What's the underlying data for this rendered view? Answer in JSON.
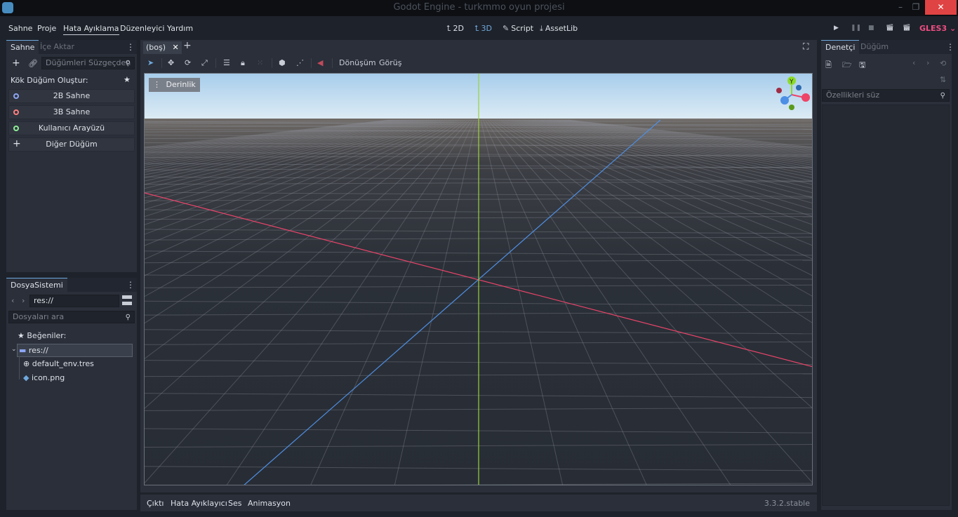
{
  "window": {
    "title": "Godot Engine - turkmmo oyun projesi"
  },
  "menu": {
    "items": [
      "Sahne",
      "Proje",
      "Hata Ayıklama",
      "Düzenleyici",
      "Yardım"
    ]
  },
  "workspaces": {
    "items": [
      {
        "label": "2D",
        "icon": "2d-icon"
      },
      {
        "label": "3D",
        "icon": "3d-icon"
      },
      {
        "label": "Script",
        "icon": "script-icon"
      },
      {
        "label": "AssetLib",
        "icon": "assetlib-icon"
      }
    ]
  },
  "renderer": "GLES3",
  "scene_panel": {
    "tabs": [
      "Sahne",
      "İçe Aktar"
    ],
    "filter_placeholder": "Düğümleri Süzgeçden",
    "root_label": "Kök Düğüm Oluştur:",
    "buttons": [
      {
        "label": "2B Sahne",
        "color": "#8da5f3"
      },
      {
        "label": "3B Sahne",
        "color": "#fc7f7f"
      },
      {
        "label": "Kullanıcı Arayüzü",
        "color": "#8eef97"
      },
      {
        "label": "Diğer Düğüm",
        "color": "#c8cdd6"
      }
    ]
  },
  "filesystem_panel": {
    "tab": "DosyaSistemi",
    "path": "res://",
    "search_placeholder": "Dosyaları ara",
    "favorites_label": "Beğeniler:",
    "root": "res://",
    "files": [
      "default_env.tres",
      "icon.png"
    ]
  },
  "editor": {
    "scene_tab": "(boş)",
    "toolbar_menus": [
      "Dönüşüm",
      "Görüş"
    ],
    "viewport_menu": "Derinlik"
  },
  "gizmo": {
    "y_label": "Y",
    "colors": {
      "x": "#ee4466",
      "y": "#8ddc28",
      "z": "#4c8fe5"
    }
  },
  "bottom": {
    "tabs": [
      "Çıktı",
      "Hata Ayıklayıcı",
      "Ses",
      "Animasyon"
    ],
    "version": "3.3.2.stable"
  },
  "inspector": {
    "tabs": [
      "Denetçi",
      "Düğüm"
    ],
    "filter_placeholder": "Özellikleri süz"
  }
}
